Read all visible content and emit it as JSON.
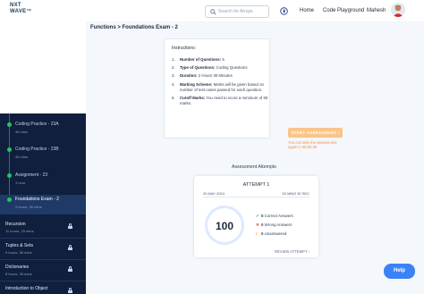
{
  "header": {
    "logo_line1": "NXT",
    "logo_line2": "WAVE",
    "logo_tm": "™",
    "search_placeholder": "Search for Arrays",
    "nav": [
      "Home",
      "Code Playground",
      "Mahesh"
    ]
  },
  "breadcrumb": "Functions > Foundations Exam - 2",
  "instructions": {
    "heading": "Instructions:",
    "items": [
      {
        "num": "1.",
        "label": "Number of Questions:",
        "value": " 5"
      },
      {
        "num": "2.",
        "label": "Type of Questions:",
        "value": " Coding Questions"
      },
      {
        "num": "3.",
        "label": "Duration:",
        "value": " 2 Hours 30 Minutes"
      },
      {
        "num": "4.",
        "label": "Marking Scheme:",
        "value": " Marks will be given based on number of test cases passed for each question."
      },
      {
        "num": "5.",
        "label": "Cutoff Marks:",
        "value": " You need to score a minimum of 60 marks."
      }
    ]
  },
  "start_button": "START ASSESSMENT  ›",
  "take_again": "You can take the assessment again in 00:00:28",
  "attempts": {
    "section_title": "Assessment Attempts",
    "card": {
      "title": "ATTEMPT 1",
      "date": "20 MAY 2024",
      "duration": "52 MINS 30 SEC",
      "score": "100",
      "results": [
        {
          "mark": "✓",
          "count": "5",
          "label": " Correct Answers",
          "color": "#16a34a"
        },
        {
          "mark": "✕",
          "count": "0",
          "label": " Wrong Answers",
          "color": "#dc2626"
        },
        {
          "mark": "!",
          "count": "0",
          "label": " Unanswered",
          "color": "#f59e0b"
        }
      ],
      "review": "REVIEW ATTEMPT  ›"
    }
  },
  "sidebar": {
    "items": [
      {
        "title": "Coding Practice - 23A",
        "meta": "45 mins"
      },
      {
        "title": "Coding Practice - 23B",
        "meta": "45 mins"
      },
      {
        "title": "Assignment - 23",
        "meta": "1 hour"
      },
      {
        "title": "Foundations Exam - 2",
        "meta": "2 hours, 30 mins"
      }
    ],
    "sections": [
      {
        "title": "Recursion",
        "meta": "11 hours, 25 mins"
      },
      {
        "title": "Tuples & Sets",
        "meta": "9 hours, 55 mins"
      },
      {
        "title": "Dictionaries",
        "meta": "8 hours, 35 mins"
      },
      {
        "title": "Introduction to Object",
        "meta": ""
      }
    ]
  },
  "help_label": "Help",
  "colors": {
    "sidebar_bg": "#0f1f3d",
    "sidebar_active": "#1f3a67",
    "accent_orange": "#fbc48a",
    "help_blue": "#3b82f6"
  }
}
